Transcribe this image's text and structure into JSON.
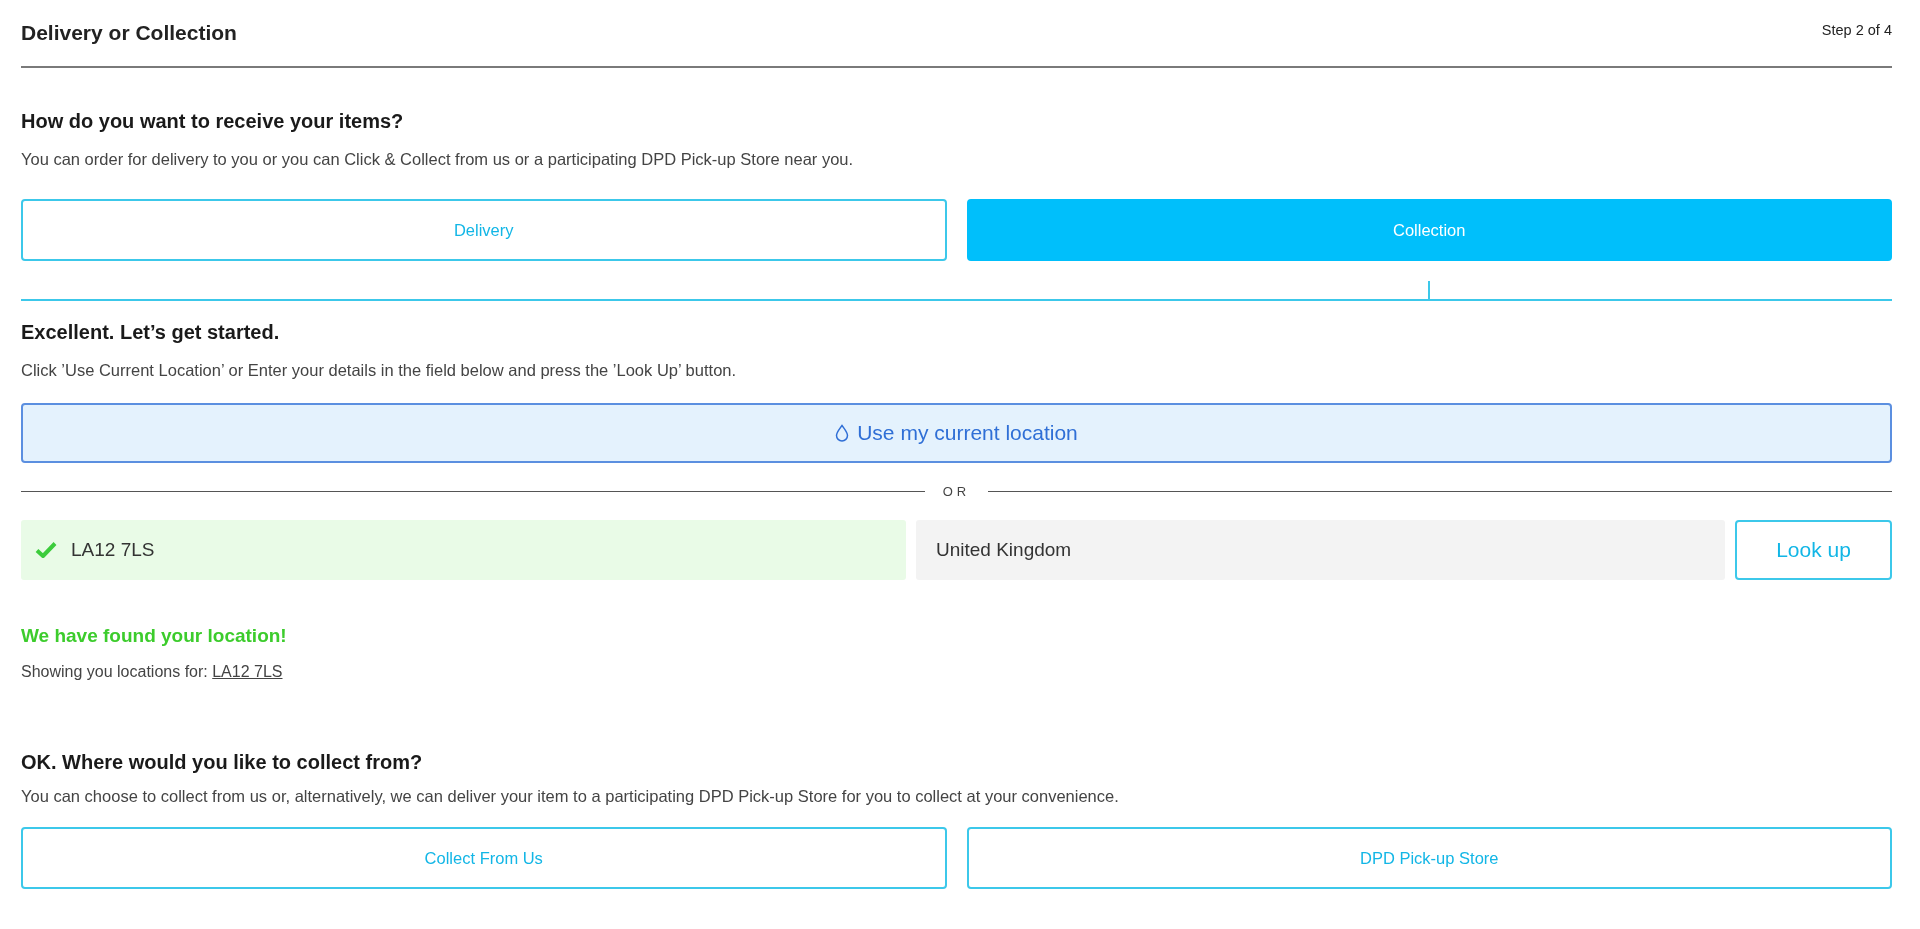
{
  "header": {
    "title": "Delivery or Collection",
    "step": "Step 2 of 4"
  },
  "method": {
    "heading": "How do you want to receive your items?",
    "description": "You can order for delivery to you or you can Click & Collect from us or a participating DPD Pick-up Store near you.",
    "options": [
      {
        "label": "Delivery",
        "selected": false
      },
      {
        "label": "Collection",
        "selected": true
      }
    ]
  },
  "location": {
    "heading": "Excellent. Let’s get started.",
    "description": "Click ’Use Current Location’ or Enter your details in the field below and press the ’Look Up’ button.",
    "current_location_button": "Use my current location",
    "separator": "OR",
    "postcode": {
      "value": "LA12 7LS",
      "valid": true
    },
    "country": {
      "value": "United Kingdom"
    },
    "lookup_button": "Look up",
    "found_message": "We have found your location!",
    "showing_label": "Showing you locations for:",
    "showing_link": "LA12 7LS"
  },
  "collect": {
    "heading": "OK. Where would you like to collect from?",
    "description": "You can choose to collect from us or, alternatively, we can deliver your item to a participating DPD Pick-up Store for you to collect at your convenience.",
    "options": [
      {
        "label": "Collect From Us",
        "selected": false
      },
      {
        "label": "DPD Pick-up Store",
        "selected": false
      }
    ]
  }
}
